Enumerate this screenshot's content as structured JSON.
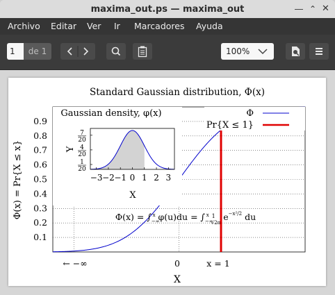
{
  "window": {
    "title": "maxima_out.ps — maxima_out"
  },
  "menu": [
    "Archivo",
    "Editar",
    "Ver",
    "Ir",
    "Marcadores",
    "Ayuda"
  ],
  "toolbar": {
    "page_value": "1",
    "page_total": "de 1",
    "zoom": "100%"
  },
  "icons": [
    "chevron-left-icon",
    "chevron-right-icon",
    "search-icon",
    "clipboard-icon",
    "chevron-down-icon",
    "document-icon",
    "hamburger-menu-icon"
  ],
  "colors": {
    "menubar": "#353535",
    "toolbar": "#3b3b3b",
    "density_curve": "#0000cc",
    "cdf_curve": "#0000cc",
    "highlight_bar": "#e00000",
    "shaded_area": "#d3d3d3"
  },
  "chart_data": [
    {
      "type": "line",
      "title": "Standard Gaussian distribution, Φ(x)",
      "xlabel": "X",
      "ylabel": "Φ(x) = Pr{X ≤ x}",
      "x_tick_labels": [
        "← −∞",
        "0",
        "x = 1"
      ],
      "y_tick_labels": [
        "0.1",
        "0.2",
        "0.3",
        "0.4",
        "0.5",
        "0.6",
        "0.7",
        "0.8",
        "0.9"
      ],
      "xlim": [
        -3.0,
        3.0
      ],
      "ylim": [
        0,
        1
      ],
      "grid": true,
      "legend_position": "top-right",
      "series": [
        {
          "name": "Φ",
          "function": "normal_cdf"
        },
        {
          "name": "Pr{X ≤ 1}",
          "x": [
            1,
            1
          ],
          "y": [
            0,
            0.8413
          ]
        }
      ],
      "annotation": "Φ(x) = ∫_{−∞}^{x} φ(u) du = ∫_{−∞}^{x} (1/√(2π)) e^{−x²/2} du"
    },
    {
      "type": "area",
      "title": "Gaussian density, φ(x)",
      "xlabel": "X",
      "ylabel": "Y",
      "x_tick_labels": [
        "−3",
        "−2",
        "−1",
        "0",
        "1",
        "2",
        "3"
      ],
      "y_tick_labels": [
        "1/20",
        "4/20",
        "7/20"
      ],
      "xlim": [
        -3.5,
        3.5
      ],
      "ylim": [
        0,
        0.42
      ],
      "series": [
        {
          "function": "normal_pdf",
          "shaded_to": 1
        }
      ]
    }
  ]
}
